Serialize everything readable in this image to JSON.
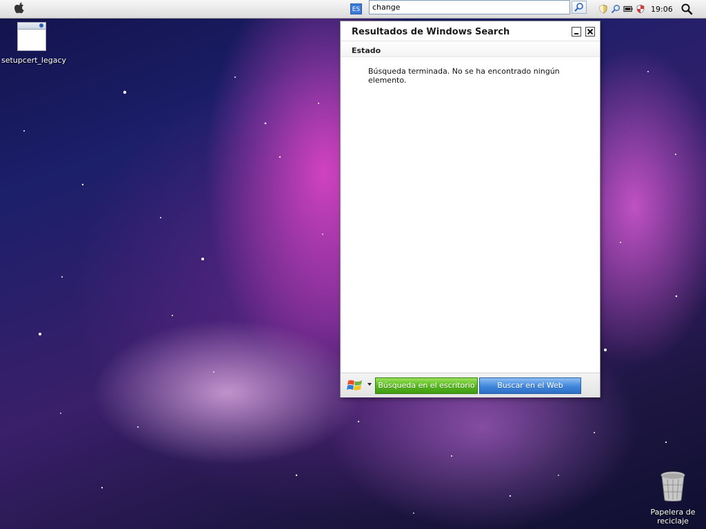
{
  "menubar": {
    "apple_icon": "apple-icon",
    "language": "ES",
    "search_value": "change",
    "search_button_icon": "magnifier-icon",
    "tray_icons": [
      "shield-icon",
      "search-tray-icon",
      "battery-icon",
      "security-shield-icon"
    ],
    "clock": "19:06",
    "spotlight_icon": "spotlight-icon"
  },
  "desktop": {
    "icons": [
      {
        "label": "setupcert_legacy",
        "icon": "window-app-icon"
      },
      {
        "label": "Papelera de reciclaje",
        "icon": "trash-icon"
      }
    ]
  },
  "search_window": {
    "title": "Resultados de Windows Search",
    "status_label": "Estado",
    "status_message": "Búsqueda terminada. No se ha encontrado ningún elemento.",
    "footer": {
      "logo_icon": "windows-logo-icon",
      "desktop_search_label": "Búsqueda en el escritorio",
      "web_search_label": "Buscar en el Web"
    }
  },
  "colors": {
    "menubar": "#dcdcdc",
    "desktop_button": "#54b51b",
    "web_button": "#3f86db",
    "wallpaper_accent": "#e146c8"
  }
}
